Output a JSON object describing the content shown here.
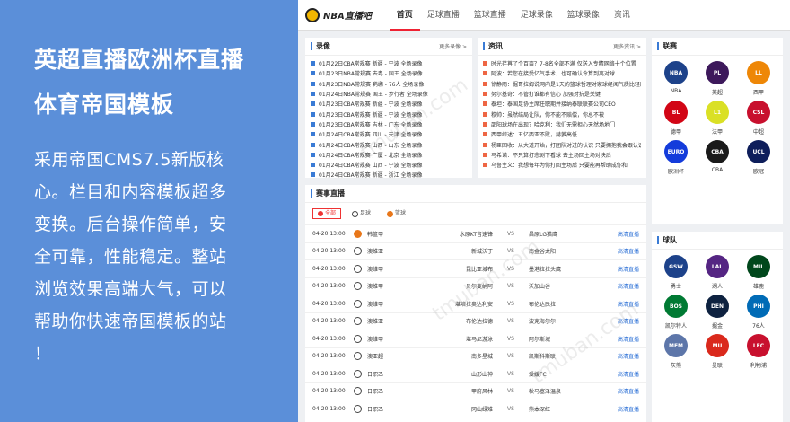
{
  "promo": {
    "line1": "英超直播欧洲杯直播",
    "line2": "体育帝国模板",
    "desc": [
      "采用帝国CMS7.5新版核",
      "心。栏目和内容模板超多",
      "变换。后台操作简单，安",
      "全可靠，性能稳定。整站",
      "浏览效果高端大气，可以",
      "帮助你快速帝国模板的站",
      "！"
    ]
  },
  "header": {
    "logo_text": "NBA直播吧",
    "nav": [
      "首页",
      "足球直播",
      "篮球直播",
      "足球录像",
      "篮球录像",
      "资讯"
    ]
  },
  "videos": {
    "title": "录像",
    "more": "更多录像 >",
    "items": [
      "01月22日CBA常规赛 新疆 - 宁波 全场录像",
      "01月23日NBA常规赛 去粤 - 国王 全场录像",
      "01月23日NBA常规赛 鹈鹕 - 76人 全场录像",
      "01月24日NBA常规赛 国王 - 步行者 全场录像",
      "01月23日CBA常规赛 新疆 - 宁波 全场录像",
      "01月23日CBA常规赛 新疆 - 宁波 全场录像",
      "01月23日CBA常规赛 吉林 - 广东 全场录像",
      "01月24日CBA常规赛 四川 - 天津 全场录像",
      "01月24日CBA常规赛 山西 - 山东 全场录像",
      "01月24日CBA常规赛 广厦 - 北京 全场录像",
      "01月24日CBA常规赛 山西 - 宁波 全场录像",
      "01月24日CBA常规赛 新疆 - 浙江 全场录像"
    ]
  },
  "news": {
    "title": "资讯",
    "more": "更多资讯 >",
    "items": [
      "时光荏苒了个百亩？7-8名全部不满 仅送入专精网络十个位置",
      "阿波：若您在接受亿气手术，也可确认令算到离对球",
      "徐静雨：掘哥拉姆说网内是1天的篮球哲理对家球经阅气质比轻压",
      "努尔基奇：不管打谁都有信心 加强对抗是关键",
      "泰坦：泰国足协主席任职期并接纳泰联联赛公司CEO",
      "穆帅：虽然结局让队，你不能不赔偿，你总不被",
      "邵阳球场在出现？哈克利：我们无需担心天然场地门",
      "西甲综述：五亿西亚不败，赫萝高低",
      "杨臣回收：从大道开始，打团队对过的认识 只要拥抱我会跟认识到",
      "马希诺：不只算打悲剧下看球 去主场回主场对决后",
      "乌鲁主义：我想每年为你打回主场后 只要能再帮助成你和"
    ]
  },
  "matches": {
    "title": "赛事直播",
    "tabs": [
      "全部",
      "足球",
      "篮球"
    ],
    "rows": [
      {
        "time": "04-20 13:00",
        "sport": "b",
        "league": "韩篮甲",
        "home": "水原KT音速锋",
        "away": "昌原LG猎鹰",
        "live": "高清直播"
      },
      {
        "time": "04-20 13:00",
        "sport": "f",
        "league": "澳维亚",
        "home": "新城沃丁",
        "away": "南金谷太阳",
        "live": "高清直播"
      },
      {
        "time": "04-20 13:00",
        "sport": "f",
        "league": "澳维甲",
        "home": "昆比亚城布",
        "away": "墨港拉拉头鹰",
        "live": "高清直播"
      },
      {
        "time": "04-20 13:00",
        "sport": "f",
        "league": "澳维甲",
        "home": "贝尔麦纳阿",
        "away": "沃加山谷",
        "live": "高清直播"
      },
      {
        "time": "04-20 13:00",
        "sport": "f",
        "league": "澳维甲",
        "home": "堪培拉奥达利安",
        "away": "布伦达民拉",
        "live": "高清直播"
      },
      {
        "time": "04-20 13:00",
        "sport": "f",
        "league": "澳维亚",
        "home": "布伦达拉德",
        "away": "波克海尔尔",
        "live": "高清直播"
      },
      {
        "time": "04-20 13:00",
        "sport": "f",
        "league": "澳维甲",
        "home": "堪马尼游泳",
        "away": "阿尔斯城",
        "live": "高清直播"
      },
      {
        "time": "04-20 13:00",
        "sport": "f",
        "league": "澳亚超",
        "home": "南多星城",
        "away": "凯斯科斯联",
        "live": "高清直播"
      },
      {
        "time": "04-20 13:00",
        "sport": "f",
        "league": "日职乙",
        "home": "山形山神",
        "away": "爱媛FC",
        "live": "高清直播"
      },
      {
        "time": "04-20 13:00",
        "sport": "f",
        "league": "日职乙",
        "home": "甲府风林",
        "away": "秋马塞泽温泉",
        "live": "高清直播"
      },
      {
        "time": "04-20 13:00",
        "sport": "f",
        "league": "日职乙",
        "home": "冈山绿雉",
        "away": "熊本深红",
        "live": "高清直播"
      },
      {
        "time": "04-20 13:00",
        "sport": "f",
        "league": "日职乙",
        "home": "清水心跳",
        "away": "仙台七夕",
        "live": "高清直播"
      }
    ]
  },
  "leagues": {
    "title": "联赛",
    "items": [
      {
        "name": "NBA",
        "badge": "NBA",
        "color": "#1d428a"
      },
      {
        "name": "英超",
        "badge": "PL",
        "color": "#3d195b"
      },
      {
        "name": "西甲",
        "badge": "LL",
        "color": "#ee8707"
      },
      {
        "name": "德甲",
        "badge": "BL",
        "color": "#d20515"
      },
      {
        "name": "法甲",
        "badge": "L1",
        "color": "#dae025"
      },
      {
        "name": "中超",
        "badge": "CSL",
        "color": "#c8102e"
      },
      {
        "name": "欧洲杯",
        "badge": "EURO",
        "color": "#143cdb"
      },
      {
        "name": "CBA",
        "badge": "CBA",
        "color": "#1a1a1a"
      },
      {
        "name": "欧冠",
        "badge": "UCL",
        "color": "#0e1e5b"
      }
    ]
  },
  "teams": {
    "title": "球队",
    "items": [
      {
        "name": "勇士",
        "badge": "GSW",
        "color": "#1d428a"
      },
      {
        "name": "湖人",
        "badge": "LAL",
        "color": "#552583"
      },
      {
        "name": "雄鹿",
        "badge": "MIL",
        "color": "#00471b"
      },
      {
        "name": "凯尔特人",
        "badge": "BOS",
        "color": "#007a33"
      },
      {
        "name": "掘金",
        "badge": "DEN",
        "color": "#0e2240"
      },
      {
        "name": "76人",
        "badge": "PHI",
        "color": "#006bb6"
      },
      {
        "name": "灰熊",
        "badge": "MEM",
        "color": "#5d76a9"
      },
      {
        "name": "曼联",
        "badge": "MU",
        "color": "#da291c"
      },
      {
        "name": "利物浦",
        "badge": "LFC",
        "color": "#c8102e"
      }
    ]
  },
  "watermark": "tmuban.com"
}
